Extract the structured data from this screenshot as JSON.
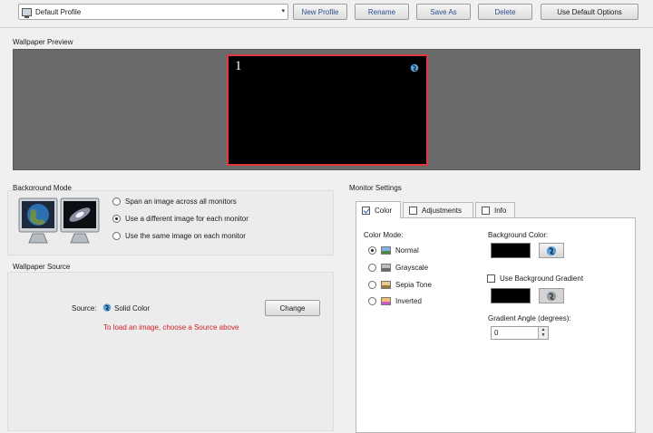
{
  "toolbar": {
    "profile_value": "Default Profile",
    "dropdown_arrow": "▾",
    "new_profile": "New Profile",
    "rename": "Rename",
    "save_as": "Save As",
    "delete": "Delete",
    "use_default_options": "Use Default Options"
  },
  "preview": {
    "title": "Wallpaper Preview",
    "monitor_number": "1",
    "accent": "#e0383f"
  },
  "background_mode": {
    "title": "Background Mode",
    "options": [
      {
        "label": "Span an image across all monitors",
        "selected": false
      },
      {
        "label": "Use a different image for each monitor",
        "selected": true
      },
      {
        "label": "Use the same image on each monitor",
        "selected": false
      }
    ]
  },
  "wallpaper_source": {
    "title": "Wallpaper Source",
    "source_label": "Source:",
    "source_value": "Solid Color",
    "change_button": "Change",
    "hint": "To load an image, choose a Source above",
    "hint_color": "#d0202a"
  },
  "monitor_settings": {
    "title": "Monitor Settings",
    "tabs": [
      {
        "label": "Color",
        "checked": true,
        "active": true
      },
      {
        "label": "Adjustments",
        "checked": false,
        "active": false
      },
      {
        "label": "Info",
        "checked": false,
        "active": false
      }
    ],
    "color_mode_label": "Color Mode:",
    "modes": [
      {
        "label": "Normal",
        "selected": true,
        "icon": "normal-icon"
      },
      {
        "label": "Grayscale",
        "selected": false,
        "icon": "grayscale-icon"
      },
      {
        "label": "Sepia Tone",
        "selected": false,
        "icon": "sepia-icon"
      },
      {
        "label": "Inverted",
        "selected": false,
        "icon": "inverted-icon"
      }
    ],
    "background_color_label": "Background Color:",
    "background_color": "#000000",
    "use_gradient_label": "Use Background Gradient",
    "use_gradient_checked": false,
    "gradient_angle_label": "Gradient Angle (degrees):",
    "gradient_angle_value": "0"
  }
}
